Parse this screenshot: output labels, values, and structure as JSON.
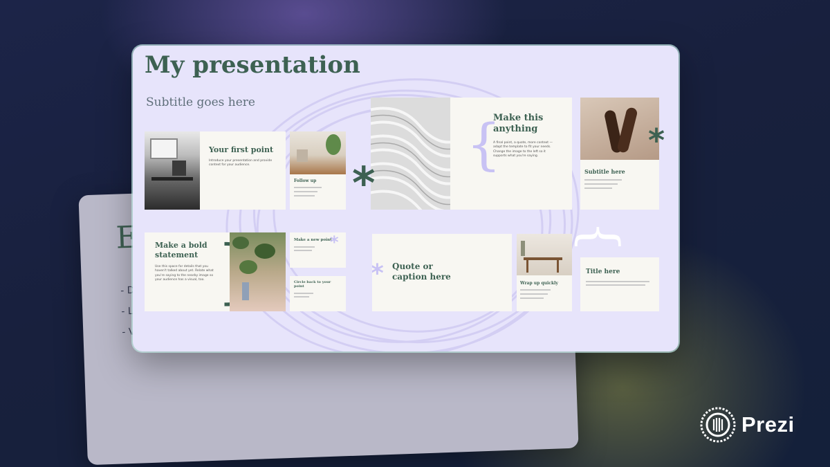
{
  "back_slide": {
    "title_initial": "E",
    "bullets": [
      "- D",
      "- L",
      "- V"
    ]
  },
  "presentation": {
    "title": "My presentation",
    "subtitle": "Subtitle goes here"
  },
  "slides": {
    "first_point": {
      "title": "Your first point",
      "body": "Introduce your presentation and provide context for your audience."
    },
    "follow_up": {
      "title": "Follow up"
    },
    "make_this": {
      "title": "Make this anything",
      "body": "A final point, a quote, more context — adapt the template to fit your needs. Change the image to the left so it supports what you're saying."
    },
    "subtitle_slide": {
      "title": "Subtitle here"
    },
    "bold_statement": {
      "title": "Make a bold statement",
      "body": "Use this space for details that you haven't talked about yet. Relate what you're saying to the nearby image so your audience has a visual, too."
    },
    "new_point": {
      "title": "Make a new point"
    },
    "back_point": {
      "title": "Circle back to your point"
    },
    "quote": {
      "title": "Quote or caption here"
    },
    "wrap_up": {
      "title": "Wrap up quickly"
    },
    "title_here": {
      "title": "Title here"
    }
  },
  "brand": {
    "name": "Prezi"
  },
  "colors": {
    "accent_green": "#3d6152",
    "card_lavender": "#e7e4fb",
    "slide_cream": "#f8f7f2",
    "accent_lavender": "#c8c2f4"
  }
}
